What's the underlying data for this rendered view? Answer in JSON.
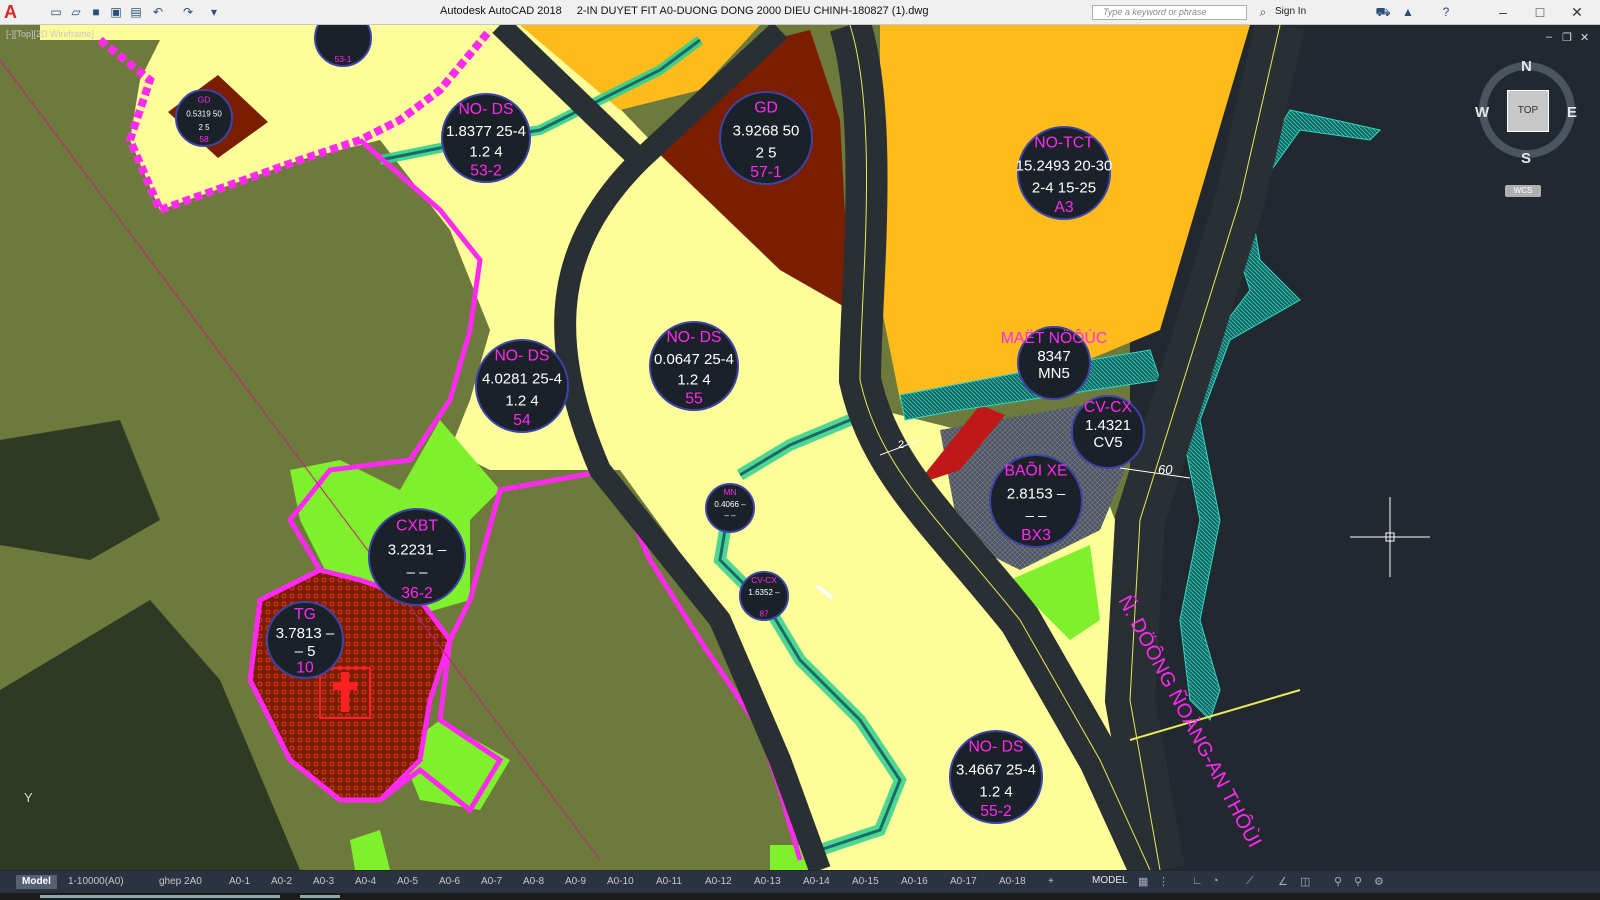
{
  "app": {
    "name": "Autodesk AutoCAD 2018",
    "file": "2-IN DUYET FIT A0-DUONG DONG 2000 DIEU CHINH-180827 (1).dwg",
    "search_placeholder": "Type a keyword or phrase",
    "sign_in": "Sign In"
  },
  "viewport": {
    "label": "[-][Top][2D Wireframe]",
    "compass": {
      "n": "N",
      "s": "S",
      "e": "E",
      "w": "W",
      "top": "TOP",
      "wcs": "WCS"
    },
    "ucs_y": "Y"
  },
  "lots": [
    {
      "l1": "",
      "l2": "",
      "l3": "",
      "foot": "53-1"
    },
    {
      "l1": "GD",
      "l2": "0.5319 50",
      "l3": "2   5",
      "foot": "58"
    },
    {
      "l1": "NO- DS",
      "l2": "1.8377 25-4",
      "l3": "1.2  4",
      "foot": "53-2"
    },
    {
      "l1": "GD",
      "l2": "3.9268 50",
      "l3": "2   5",
      "foot": "57-1"
    },
    {
      "l1": "NO-TCT",
      "l2": "15.2493 20-30",
      "l3": "2-4 15-25",
      "foot": "A3"
    },
    {
      "l1": "MAËT NÖÔÙC",
      "l2": "8347",
      "l3": "MN5",
      "foot": ""
    },
    {
      "l1": "CV-CX",
      "l2": "1.4321",
      "l3": "CV5",
      "foot": ""
    },
    {
      "l1": "BAÕI XE",
      "l2": "2.8153  –",
      "l3": "–   –",
      "foot": "BX3"
    },
    {
      "l1": "NO- DS",
      "l2": "0.0647 25-4",
      "l3": "1.2  4",
      "foot": "55"
    },
    {
      "l1": "NO- DS",
      "l2": "4.0281 25-4",
      "l3": "1.2  4",
      "foot": "54"
    },
    {
      "l1": "CXBT",
      "l2": "3.2231  –",
      "l3": "–   –",
      "foot": "36-2"
    },
    {
      "l1": "TG",
      "l2": "3.7813  –",
      "l3": "–   5",
      "foot": "10"
    },
    {
      "l1": "MN",
      "l2": "0.4066  –",
      "l3": "–  –",
      "foot": ""
    },
    {
      "l1": "CV-CX",
      "l2": "1.6352  –",
      "l3": "",
      "foot": "87"
    },
    {
      "l1": "NO- DS",
      "l2": "3.4667 25-4",
      "l3": "1.2  4",
      "foot": "55-2"
    }
  ],
  "road_dims": {
    "d1": "60",
    "d2": "2"
  },
  "road_label": "Ñ. DÖÔNG ÑOÀNG-AN THÔÙI",
  "layout_tabs": [
    "Model",
    "1-10000(A0)",
    "ghep 2A0",
    "A0-1",
    "A0-2",
    "A0-3",
    "A0-4",
    "A0-5",
    "A0-6",
    "A0-7",
    "A0-8",
    "A0-9",
    "A0-10",
    "A0-11",
    "A0-12",
    "A0-13",
    "A0-14",
    "A0-15",
    "A0-16",
    "A0-17",
    "A0-18",
    "+"
  ],
  "status": {
    "model": "MODEL"
  },
  "colors": {
    "olive": "#6e7a3c",
    "yellow": "#fdfd9a",
    "orange": "#ffbb1c",
    "brown": "#7b1e00",
    "lime": "#7ef02c",
    "magenta": "#ff2af0",
    "dark": "#212830",
    "teal": "#1eb4a0",
    "road": "#2a2f34"
  }
}
